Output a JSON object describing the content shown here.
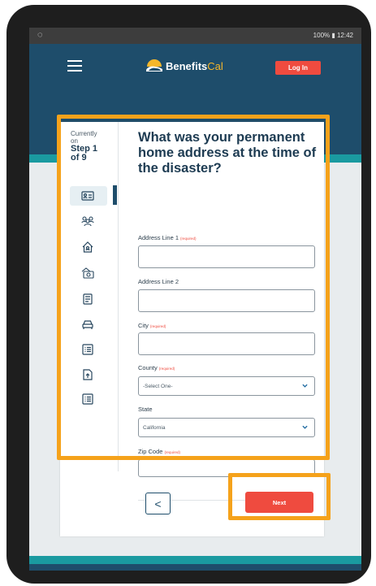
{
  "status_bar": {
    "right_text": "100% ▮ 12:42"
  },
  "header": {
    "logo_text_1": "Benefits",
    "logo_text_2": "Cal",
    "login_label": "Log In"
  },
  "progress": {
    "line1": "Currently",
    "line2": "on",
    "step_line1": "Step 1",
    "step_line2": "of 9",
    "icons": [
      "id-card-icon",
      "people-icon",
      "home-icon",
      "money-icon",
      "document-icon",
      "car-icon",
      "list-icon",
      "upload-document-icon",
      "checklist-icon"
    ]
  },
  "form": {
    "question": "What was your permanent home address at the time of the disaster?",
    "address1_label": "Address Line 1",
    "address2_label": "Address Line 2",
    "city_label": "City",
    "county_label": "County",
    "county_value": "-Select One-",
    "state_label": "State",
    "state_value": "California",
    "zip_label": "Zip Code",
    "required_text": "(required)"
  },
  "footer": {
    "back_label": "<",
    "next_label": "Next"
  },
  "colors": {
    "navy": "#1e4d6b",
    "teal": "#1a9aa0",
    "red": "#ef4b3f",
    "highlight": "#f5a21b"
  }
}
